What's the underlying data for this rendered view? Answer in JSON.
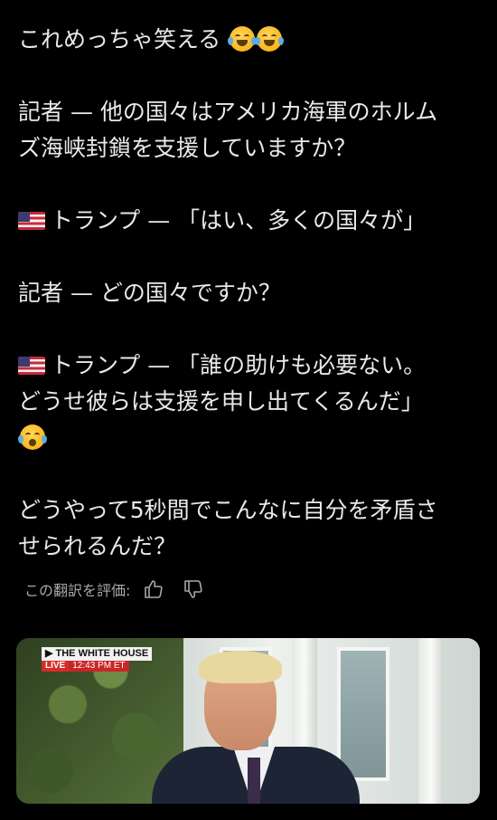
{
  "post": {
    "line1": "これめっちゃ笑える",
    "line2": "記者 — 他の国々はアメリカ海軍のホルム",
    "line3": "ズ海峡封鎖を支援していますか？",
    "line4": "トランプ — 「はい、多くの国々が」",
    "line5": "記者 — どの国々ですか？",
    "line6": "トランプ — 「誰の助けも必要ない。",
    "line7": "どうせ彼らは支援を申し出てくるんだ」",
    "line8": "どうやって5秒間でこんなに自分を矛盾さ",
    "line9": "せられるんだ？"
  },
  "icons": {
    "laugh_emoji": "face-with-tears-of-joy",
    "cry_emoji": "loudly-crying-face",
    "flag": "us-flag",
    "thumbs_up": "thumbs-up-outline",
    "thumbs_down": "thumbs-down-outline"
  },
  "translation": {
    "rate_label": "この翻訳を評価:"
  },
  "media": {
    "chyron_title": "THE WHITE HOUSE",
    "chyron_live": "LIVE",
    "chyron_time": "12:43 PM ET"
  }
}
